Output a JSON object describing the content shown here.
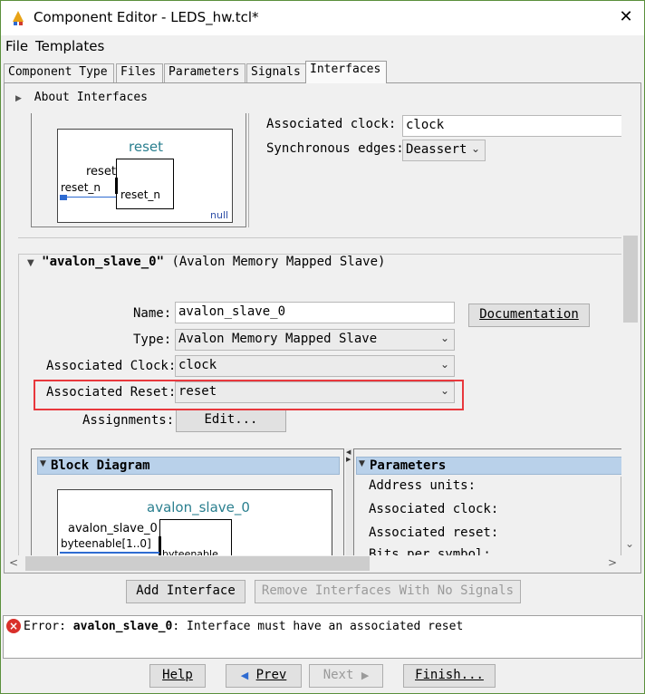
{
  "window": {
    "title": "Component Editor - LEDS_hw.tcl*",
    "close_glyph": "✕"
  },
  "menu": {
    "file": "File",
    "templates": "Templates"
  },
  "tabs": [
    {
      "label": "Component Type"
    },
    {
      "label": "Files"
    },
    {
      "label": "Parameters"
    },
    {
      "label": "Signals"
    },
    {
      "label": "Interfaces"
    }
  ],
  "about_interfaces": "About Interfaces",
  "reset_interface": {
    "diagram_title": "reset",
    "port_outer": "reset_n",
    "port_label": "reset",
    "port_inner": "reset_n",
    "footer": "null",
    "associated_clock_label": "Associated clock:",
    "associated_clock_value": "clock",
    "sync_edges_label": "Synchronous edges:",
    "sync_edges_value": "Deassert"
  },
  "avalon": {
    "header_name": "\"avalon_slave_0\"",
    "header_type": "(Avalon Memory Mapped Slave)",
    "name_label": "Name:",
    "name_value": "avalon_slave_0",
    "documentation_button": "Documentation",
    "type_label": "Type:",
    "type_value": "Avalon Memory Mapped Slave",
    "clock_label": "Associated Clock:",
    "clock_value": "clock",
    "reset_label": "Associated Reset:",
    "reset_value": "reset",
    "assignments_label": "Assignments:",
    "edit_button": "Edit...",
    "block_diagram_title": "Block Diagram",
    "diagram_name": "avalon_slave_0",
    "diagram_port_label": "avalon_slave_0",
    "diagram_port_outer": "byteenable[1..0]",
    "diagram_port_inner": "byteenable",
    "parameters_title": "Parameters",
    "params": [
      {
        "label": "Address units:"
      },
      {
        "label": "Associated clock:"
      },
      {
        "label": "Associated reset:"
      },
      {
        "label": "Bits per symbol:"
      }
    ]
  },
  "actions": {
    "add_interface": "Add Interface",
    "remove_interfaces": "Remove Interfaces With No Signals"
  },
  "error": {
    "prefix": "Error: ",
    "subject": "avalon_slave_0",
    "message": ": Interface must have an associated reset"
  },
  "footer_buttons": {
    "help": "Help",
    "prev": "Prev",
    "next": "Next",
    "finish": "Finish..."
  },
  "colors": {
    "error_highlight": "#e8383d",
    "section_header": "#b9d1ea",
    "diagram_title": "#2a7f8f"
  }
}
